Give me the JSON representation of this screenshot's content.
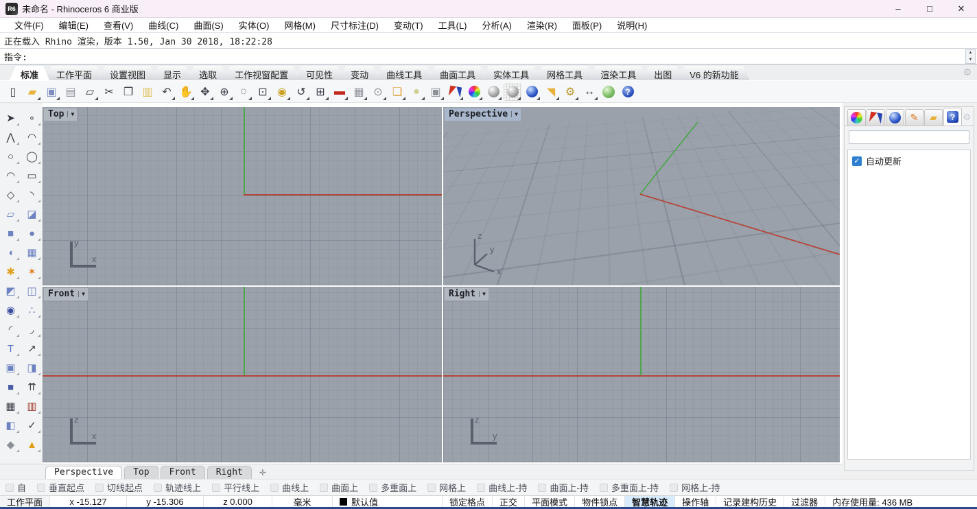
{
  "window": {
    "title": "未命名 - Rhinoceros 6 商业版",
    "icon_label": "R6",
    "controls": {
      "minimize": "–",
      "maximize": "□",
      "close": "✕"
    }
  },
  "menu": {
    "items": [
      "文件(F)",
      "编辑(E)",
      "查看(V)",
      "曲线(C)",
      "曲面(S)",
      "实体(O)",
      "网格(M)",
      "尺寸标注(D)",
      "变动(T)",
      "工具(L)",
      "分析(A)",
      "渲染(R)",
      "面板(P)",
      "说明(H)"
    ]
  },
  "command": {
    "history": "正在载入 Rhino 渲染，版本 1.50, Jan 30 2018, 18:22:28",
    "prompt": "指令:",
    "input": "",
    "scroll_up": "▲",
    "scroll_down": "▼"
  },
  "tabbar": {
    "gear_glyph": "⚙",
    "tabs": [
      {
        "label": "标准",
        "active": true
      },
      {
        "label": "工作平面"
      },
      {
        "label": "设置视图"
      },
      {
        "label": "显示"
      },
      {
        "label": "选取"
      },
      {
        "label": "工作视窗配置"
      },
      {
        "label": "可见性"
      },
      {
        "label": "变动"
      },
      {
        "label": "曲线工具"
      },
      {
        "label": "曲面工具"
      },
      {
        "label": "实体工具"
      },
      {
        "label": "网格工具"
      },
      {
        "label": "渲染工具"
      },
      {
        "label": "出图"
      },
      {
        "label": "V6 的新功能"
      }
    ]
  },
  "toolbar": {
    "icons": [
      {
        "name": "new-file-icon",
        "glyph": "▯"
      },
      {
        "name": "open-file-icon",
        "glyph": "▰",
        "color": "#e8b23a",
        "flyout": true
      },
      {
        "name": "save-icon",
        "glyph": "▣",
        "color": "#7f8cc0",
        "flyout": true
      },
      {
        "name": "print-icon",
        "glyph": "▤",
        "color": "#8d929a"
      },
      {
        "name": "copy-page-icon",
        "glyph": "▱",
        "flyout": true
      },
      {
        "name": "cut-icon",
        "glyph": "✂"
      },
      {
        "name": "copy-icon",
        "glyph": "❐"
      },
      {
        "name": "paste-icon",
        "glyph": "▥",
        "color": "#dfc05a"
      },
      {
        "name": "undo-icon",
        "glyph": "↶",
        "flyout": true
      },
      {
        "name": "pan-icon",
        "glyph": "✋",
        "flyout": true
      },
      {
        "name": "rotate-view-icon",
        "glyph": "✥",
        "flyout": true
      },
      {
        "name": "zoom-dynamic-icon",
        "glyph": "⊕",
        "flyout": true
      },
      {
        "name": "zoom-window-icon",
        "glyph": "◌",
        "flyout": true
      },
      {
        "name": "zoom-extents-icon",
        "glyph": "⊡",
        "flyout": true
      },
      {
        "name": "zoom-selected-icon",
        "glyph": "◉",
        "color": "#caa21e",
        "flyout": true
      },
      {
        "name": "undo-view-icon",
        "glyph": "↺",
        "flyout": true
      },
      {
        "name": "viewport-layout-icon",
        "glyph": "⊞",
        "flyout": true
      },
      {
        "name": "named-view-car-icon",
        "glyph": "▬",
        "color": "#c22a1e",
        "flyout": true
      },
      {
        "name": "cplane-icon",
        "glyph": "▦",
        "color": "#8d929a",
        "flyout": true
      },
      {
        "name": "circle-center-icon",
        "glyph": "⊙",
        "color": "#8d929a",
        "flyout": true
      },
      {
        "name": "object-display-icon",
        "glyph": "❏",
        "color": "#dd9a2e",
        "flyout": true
      },
      {
        "name": "lightbulb-icon",
        "glyph": "●",
        "color": "#cfcf8e",
        "flyout": true
      },
      {
        "name": "lock-icon",
        "glyph": "▣",
        "color": "#8d929a",
        "flyout": true
      },
      {
        "name": "shaded-mode-icon",
        "glyph": "",
        "flyout": true
      },
      {
        "name": "render-color-wheel-icon",
        "glyph": "",
        "flyout": true
      },
      {
        "name": "render-sphere-icon",
        "glyph": "",
        "flyout": true
      },
      {
        "name": "render-sphere-grid-icon",
        "glyph": "",
        "flyout": true
      },
      {
        "name": "blue-sphere-icon",
        "glyph": "",
        "flyout": true
      },
      {
        "name": "spotlight-icon",
        "glyph": "◥",
        "color": "#e8b23a",
        "flyout": true
      },
      {
        "name": "gears-icon",
        "glyph": "⚙",
        "color": "#b8962e",
        "flyout": true
      },
      {
        "name": "dimension-icon",
        "glyph": "↔",
        "flyout": true
      },
      {
        "name": "earth-icon",
        "glyph": ""
      },
      {
        "name": "help-icon",
        "glyph": "?"
      }
    ]
  },
  "left_toolbar": {
    "icons": [
      {
        "name": "select-arrow-icon",
        "glyph": "➤",
        "color": "#33383f"
      },
      {
        "name": "point-icon",
        "glyph": "∘"
      },
      {
        "name": "polyline-icon",
        "glyph": "⋀"
      },
      {
        "name": "control-curve-icon",
        "glyph": "◠"
      },
      {
        "name": "circle-icon",
        "glyph": "○"
      },
      {
        "name": "ellipse-icon",
        "glyph": "◯"
      },
      {
        "name": "arc-icon",
        "glyph": "◠"
      },
      {
        "name": "rectangle-icon",
        "glyph": "▭"
      },
      {
        "name": "polygon-icon",
        "glyph": "◇"
      },
      {
        "name": "corner-curve-icon",
        "glyph": "◝"
      },
      {
        "name": "surface-3pt-icon",
        "glyph": "▱",
        "color": "#6d82c2"
      },
      {
        "name": "surface-patch-icon",
        "glyph": "◪",
        "color": "#6d82c2"
      },
      {
        "name": "box-icon",
        "glyph": "■",
        "color": "#6d82c2"
      },
      {
        "name": "sphere-icon",
        "glyph": "●",
        "color": "#6d82c2"
      },
      {
        "name": "revolve-icon",
        "glyph": "◖",
        "color": "#6d82c2"
      },
      {
        "name": "surface-grid-icon",
        "glyph": "▦",
        "color": "#6d82c2"
      },
      {
        "name": "boolean-union-icon",
        "glyph": "✱",
        "color": "#dfa018"
      },
      {
        "name": "explode-icon",
        "glyph": "✶",
        "color": "#e07818"
      },
      {
        "name": "trim-icon",
        "glyph": "◩",
        "color": "#6d82c2"
      },
      {
        "name": "split-icon",
        "glyph": "◫",
        "color": "#6d82c2"
      },
      {
        "name": "drape-icon",
        "glyph": "◉",
        "color": "#3a4d9e"
      },
      {
        "name": "group-icon",
        "glyph": "∴",
        "color": "#6d82c2"
      },
      {
        "name": "fillet-curve-icon",
        "glyph": "◜"
      },
      {
        "name": "blend-curve-icon",
        "glyph": "◞"
      },
      {
        "name": "text-icon",
        "glyph": "T",
        "color": "#5c74c4"
      },
      {
        "name": "scale-icon",
        "glyph": "↗"
      },
      {
        "name": "align-icon",
        "glyph": "▣",
        "color": "#6d82c2"
      },
      {
        "name": "mirror-icon",
        "glyph": "◨",
        "color": "#6d82c2"
      },
      {
        "name": "solid-edit-icon",
        "glyph": "■",
        "color": "#4a5da8"
      },
      {
        "name": "extrude-icon",
        "glyph": "⇈"
      },
      {
        "name": "array-icon",
        "glyph": "▦"
      },
      {
        "name": "array-curve-icon",
        "glyph": "▥",
        "color": "#a33a2e"
      },
      {
        "name": "flip-icon",
        "glyph": "◧",
        "color": "#6d82c2"
      },
      {
        "name": "check-icon",
        "glyph": "✓"
      },
      {
        "name": "primitives-icon",
        "glyph": "◆",
        "color": "#8a8f98"
      },
      {
        "name": "pyramid-icon",
        "glyph": "▲",
        "color": "#dfa018"
      }
    ]
  },
  "viewports": {
    "colors": {
      "x_axis": "#b5463c",
      "y_axis": "#4ca64c",
      "background": "#9aa1aa"
    },
    "top": {
      "label": "Top",
      "caret": "▼",
      "axis_h": "x",
      "axis_v": "y"
    },
    "persp": {
      "label": "Perspective",
      "caret": "▼",
      "axis_1": "z",
      "axis_2": "y",
      "axis_3": "x"
    },
    "front": {
      "label": "Front",
      "caret": "▼",
      "axis_h": "x",
      "axis_v": "z"
    },
    "right": {
      "label": "Right",
      "caret": "▼",
      "axis_h": "y",
      "axis_v": "z"
    }
  },
  "right_panel": {
    "gear_glyph": "⚙",
    "tabs": [
      {
        "name": "panel-tab-colors",
        "glyph": ""
      },
      {
        "name": "panel-tab-display",
        "glyph": ""
      },
      {
        "name": "panel-tab-render",
        "glyph": ""
      },
      {
        "name": "panel-tab-brush",
        "glyph": "✎"
      },
      {
        "name": "panel-tab-folder",
        "glyph": "▰"
      },
      {
        "name": "panel-tab-help",
        "glyph": "?",
        "active": true
      }
    ],
    "auto_update": {
      "label": "自动更新",
      "checked": true,
      "check_glyph": "✓"
    }
  },
  "viewport_tabs": {
    "add_glyph": "✛",
    "tabs": [
      {
        "label": "Perspective",
        "active": true
      },
      {
        "label": "Top"
      },
      {
        "label": "Front"
      },
      {
        "label": "Right"
      }
    ]
  },
  "osnap": {
    "items": [
      "自",
      "垂直起点",
      "切线起点",
      "轨迹线上",
      "平行线上",
      "曲线上",
      "曲面上",
      "多重面上",
      "网格上",
      "曲线上-持",
      "曲面上-持",
      "多重面上-持",
      "网格上-持"
    ]
  },
  "statusbar": {
    "cplane": "工作平面",
    "x": "x -15.127",
    "y": "y -15.306",
    "z": "z 0.000",
    "units": "毫米",
    "layer": "默认值",
    "toggles": [
      {
        "label": "锁定格点"
      },
      {
        "label": "正交"
      },
      {
        "label": "平面模式"
      },
      {
        "label": "物件锁点"
      },
      {
        "label": "智慧轨迹",
        "active": true
      },
      {
        "label": "操作轴"
      },
      {
        "label": "记录建构历史"
      },
      {
        "label": "过滤器"
      }
    ],
    "memory": "内存使用量: 436 MB"
  }
}
